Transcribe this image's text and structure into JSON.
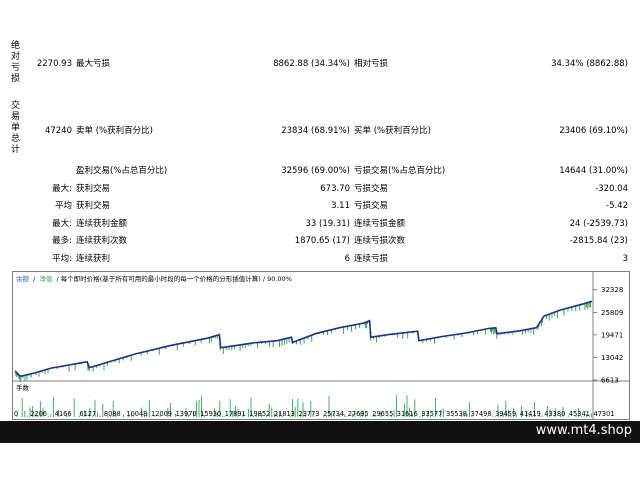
{
  "report": {
    "absolute_drawdown": {
      "heading": "绝对亏损",
      "value": "2270.93",
      "max_label": "最大亏损",
      "max_value": "8862.88 (34.34%)",
      "rel_label": "相对亏损",
      "rel_value": "34.34% (8862.88)"
    },
    "total_trades": {
      "heading": "交易单总计",
      "value": "47240",
      "short_label": "卖单 (%获利百分比)",
      "short_value": "23834 (68.91%)",
      "long_label": "买单 (%获利百分比)",
      "long_value": "23406 (69.10%)"
    },
    "profit_trades_label": "盈利交易(%占总百分比)",
    "profit_trades_value": "32596 (69.00%)",
    "loss_trades_label": "亏损交易(%占总百分比)",
    "loss_trades_value": "14644 (31.00%)",
    "rows": [
      {
        "prefix": "最大:",
        "left_label": "获利交易",
        "left_value": "673.70",
        "right_label": "亏损交易",
        "right_value": "-320.04"
      },
      {
        "prefix": "平均",
        "left_label": "获利交易",
        "left_value": "3.11",
        "right_label": "亏损交易",
        "right_value": "-5.42"
      },
      {
        "prefix": "最大:",
        "left_label": "连续获利金额",
        "left_value": "33 (19.31)",
        "right_label": "连续亏损金额",
        "right_value": "24 (-2539.73)"
      },
      {
        "prefix": "最多:",
        "left_label": "连续获利次数",
        "left_value": "1870.65 (17)",
        "right_label": "连续亏损次数",
        "right_value": "-2815.84 (23)"
      },
      {
        "prefix": "平均:",
        "left_label": "连续获利",
        "left_value": "6",
        "right_label": "连续亏损",
        "right_value": "3"
      }
    ]
  },
  "chart": {
    "legend_balance": "余额",
    "legend_sep": "/",
    "legend_equity": "净值",
    "legend_rest": "/ 每个即时价格(基于所有可用的最小时段的每一个价格的分形插值计算) / 90.00%",
    "volume_label": "手数",
    "colors": {
      "balance": "#1f2f8a",
      "equity": "#2fa84f",
      "volume": "#2fa84f",
      "legend": "#2b5fd9"
    }
  },
  "chart_data": {
    "type": "line",
    "xlabel": "",
    "ylabel": "",
    "x_ticks": [
      "0",
      "2206",
      "4166",
      "6127",
      "8088",
      "10048",
      "12009",
      "13970",
      "15930",
      "17891",
      "19852",
      "21813",
      "23773",
      "25734",
      "27695",
      "29655",
      "31616",
      "33577",
      "35538",
      "37498",
      "39459",
      "41419",
      "43380",
      "45341",
      "47301"
    ],
    "y_ticks": [
      "32328",
      "25809",
      "19471",
      "13042",
      "6613"
    ],
    "ylim": [
      6613,
      34500
    ],
    "xlim": [
      0,
      48000
    ],
    "series": [
      {
        "x": [
          0,
          400,
          500,
          1500,
          3000,
          6000,
          6200,
          8000,
          10000,
          13000,
          16000,
          17000,
          17100,
          18500,
          19852,
          21813,
          23000,
          23100,
          25000,
          27000,
          29000,
          29500,
          29600,
          31000,
          33500,
          33600,
          35538,
          37498,
          39459,
          40000,
          40100,
          42000,
          43380,
          44000,
          45341,
          47301,
          48000
        ],
        "values": [
          9200,
          7800,
          7700,
          8500,
          10000,
          11800,
          10100,
          12000,
          14000,
          16500,
          18500,
          19500,
          15800,
          16500,
          17200,
          17800,
          18800,
          17300,
          19800,
          21500,
          22800,
          23500,
          18800,
          19500,
          20500,
          17800,
          19000,
          20000,
          21300,
          21500,
          19800,
          20600,
          21500,
          24800,
          26500,
          28300,
          29000
        ]
      }
    ]
  },
  "footer": {
    "site": "www.mt4.shop"
  }
}
